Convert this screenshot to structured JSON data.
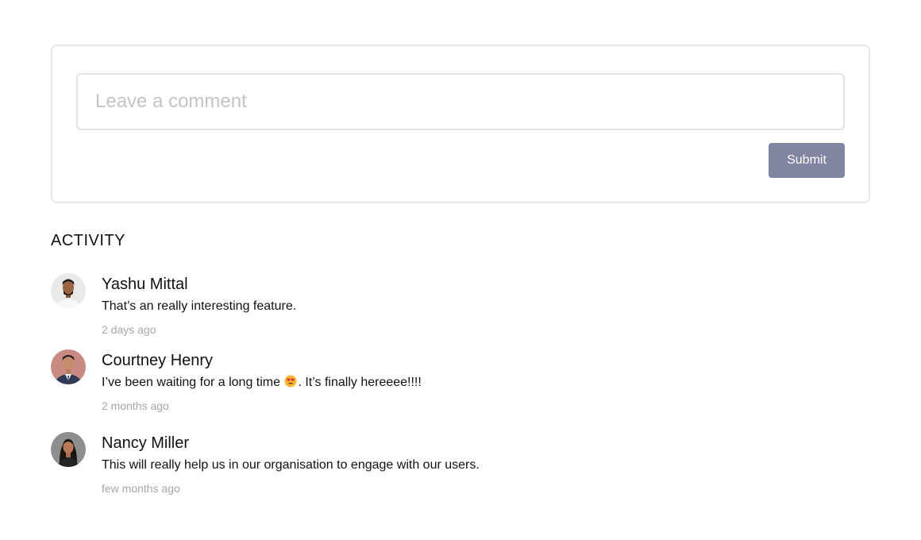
{
  "comment_form": {
    "placeholder": "Leave a comment",
    "value": "",
    "submit_label": "Submit"
  },
  "activity": {
    "heading": "ACTIVITY",
    "items": [
      {
        "author": "Yashu Mittal",
        "text": "That’s an really interesting feature.",
        "time": "2 days ago",
        "avatar_icon": "avatar-man-white-shirt"
      },
      {
        "author": "Courtney Henry",
        "text_before_emoji": "I’ve been waiting for a long time ",
        "emoji": "heart-eyes-emoji",
        "text_after_emoji": ". It’s finally hereeee!!!!",
        "time": "2 months ago",
        "avatar_icon": "avatar-man-suit"
      },
      {
        "author": "Nancy Miller",
        "text": "This will really help us in our organisation to engage with our users.",
        "time": "few months ago",
        "avatar_icon": "avatar-woman"
      }
    ]
  },
  "colors": {
    "submit_bg": "#8185a1",
    "border": "#e5e5e5",
    "muted_text": "#a6a6a6"
  }
}
